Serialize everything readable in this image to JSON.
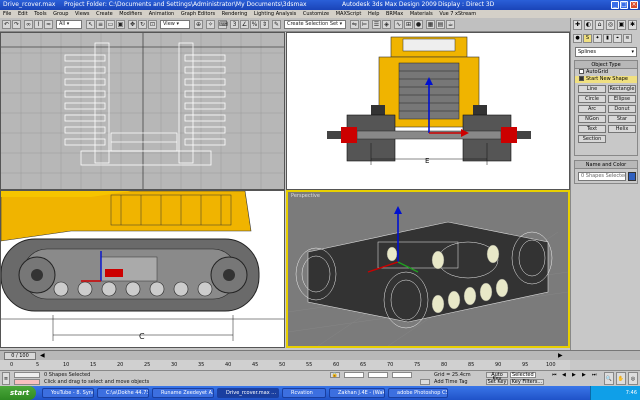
{
  "window": {
    "filename": "Drive_rcover.max",
    "project_folder": "Project Folder: C:\\Documents and Settings\\Administrator\\My Documents\\3dsmax",
    "app_title": "Autodesk 3ds Max Design 2009",
    "display": "Display : Direct 3D"
  },
  "menu": [
    "File",
    "Edit",
    "Tools",
    "Group",
    "Views",
    "Create",
    "Modifiers",
    "Animation",
    "Graph Editors",
    "Rendering",
    "Lighting Analysis",
    "Customize",
    "MAXScript",
    "Help",
    "BRMax",
    "Materials",
    "Vue  7 xStream"
  ],
  "toolbar": {
    "filter": "All",
    "view": "View",
    "selection_set": "Create Selection Set"
  },
  "viewports": {
    "perspective_label": "Perspective"
  },
  "dimension_labels": {
    "front": "E",
    "left": "C"
  },
  "command_panel": {
    "category": "Splines",
    "object_type_header": "Object Type",
    "autogrid": "AutoGrid",
    "start_new_shape": "Start New Shape",
    "buttons": [
      "Line",
      "Rectangle",
      "Circle",
      "Ellipse",
      "Arc",
      "Donut",
      "NGon",
      "Star",
      "Text",
      "Helix",
      "Section"
    ],
    "name_color_header": "Name and Color",
    "name_value": "0 Shapes Selected"
  },
  "timeline": {
    "frame_display": "0 / 100",
    "ticks": [
      "0",
      "5",
      "10",
      "15",
      "20",
      "25",
      "30",
      "35",
      "40",
      "45",
      "50",
      "55",
      "60",
      "65",
      "70",
      "75",
      "80",
      "85",
      "90",
      "95",
      "100"
    ]
  },
  "status": {
    "selected": "0 Shapes Selected",
    "prompt": "Click and drag to select and move objects",
    "grid": "Grid = 25.4cm",
    "add_time_tag": "Add Time Tag",
    "auto_key": "Auto Key",
    "set_key": "Set Key",
    "key_mode": "Selected",
    "key_filters": "Key Filters..."
  },
  "taskbar": {
    "start": "start",
    "tasks": [
      "YouTube - 8. Sync...",
      "C:\\a\\Dokhe 44.73...",
      "Runame Zeedeyet A...",
      "Drive_rcover.max ...",
      "Rcvation",
      "Zakhan J.4E - (Waka...",
      "adobe Photoshop CS..."
    ],
    "clock": "7:46"
  },
  "colors": {
    "title_blue": "#1a44b8",
    "machine_yellow": "#f0b400",
    "active_viewport_border": "#e8d000",
    "red_axis": "#cc0000",
    "blue_axis": "#0010d0",
    "start_green": "#2e8a22"
  }
}
